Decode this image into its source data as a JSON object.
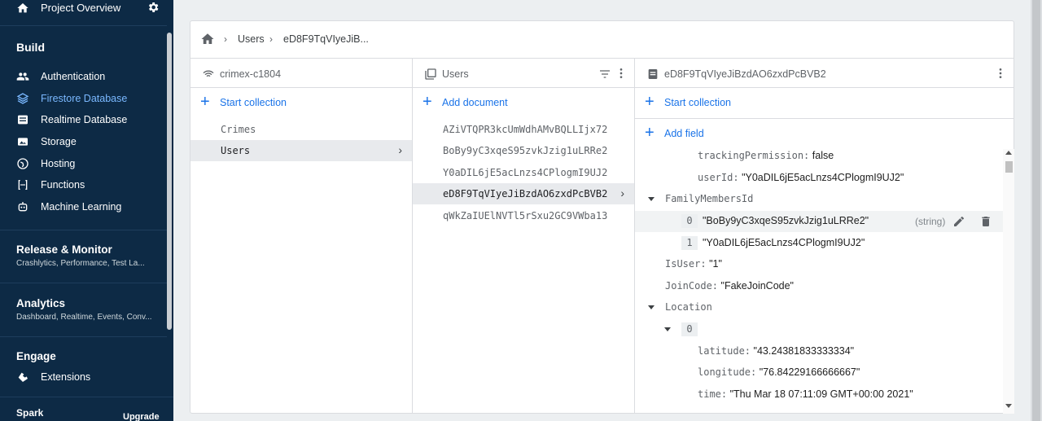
{
  "sidebar": {
    "project_overview": "Project Overview",
    "build_title": "Build",
    "build_items": [
      {
        "label": "Authentication",
        "icon": "users-icon"
      },
      {
        "label": "Firestore Database",
        "icon": "firestore-icon"
      },
      {
        "label": "Realtime Database",
        "icon": "database-icon"
      },
      {
        "label": "Storage",
        "icon": "storage-icon"
      },
      {
        "label": "Hosting",
        "icon": "globe-icon"
      },
      {
        "label": "Functions",
        "icon": "functions-icon"
      },
      {
        "label": "Machine Learning",
        "icon": "robot-icon"
      }
    ],
    "release_title": "Release & Monitor",
    "release_sub": "Crashlytics, Performance, Test La...",
    "analytics_title": "Analytics",
    "analytics_sub": "Dashboard, Realtime, Events, Conv...",
    "engage_title": "Engage",
    "extensions": "Extensions",
    "plan": "Spark",
    "upgrade": "Upgrade",
    "accent_color": "#7ab8ff",
    "bg_color": "#0d2a45"
  },
  "breadcrumb": {
    "items": [
      "Users",
      "eD8F9TqVIyeJiB..."
    ]
  },
  "col1": {
    "header": "crimex-c1804",
    "action": "Start collection",
    "items": [
      "Crimes",
      "Users"
    ],
    "selected": "Users"
  },
  "col2": {
    "header": "Users",
    "action": "Add document",
    "items": [
      "AZiVTQPR3kcUmWdhAMvBQLLIjx72",
      "BoBy9yC3xqeS95zvkJzig1uLRRe2",
      "Y0aDIL6jE5acLnzs4CPlogmI9UJ2",
      "eD8F9TqVIyeJiBzdAO6zxdPcBVB2",
      "qWkZaIUElNVTl5rSxu2GC9VWba13"
    ],
    "selected": "eD8F9TqVIyeJiBzdAO6zxdPcBVB2"
  },
  "col3": {
    "header": "eD8F9TqVIyeJiBzdAO6zxdPcBVB2",
    "action_collection": "Start collection",
    "action_field": "Add field",
    "fields": {
      "tracking_key": "trackingPermission:",
      "tracking_val": "false",
      "userid_key": "userId:",
      "userid_val": "\"Y0aDIL6jE5acLnzs4CPlogmI9UJ2\"",
      "family_key": "FamilyMembersId",
      "family_0_idx": "0",
      "family_0_val": "\"BoBy9yC3xqeS95zvkJzig1uLRRe2\"",
      "family_0_type": "(string)",
      "family_1_idx": "1",
      "family_1_val": "\"Y0aDIL6jE5acLnzs4CPlogmI9UJ2\"",
      "isuser_key": "IsUser:",
      "isuser_val": "\"1\"",
      "joincode_key": "JoinCode:",
      "joincode_val": "\"FakeJoinCode\"",
      "location_key": "Location",
      "location_0_idx": "0",
      "lat_key": "latitude:",
      "lat_val": "\"43.24381833333334\"",
      "lon_key": "longitude:",
      "lon_val": "\"76.84229166666667\"",
      "time_key": "time:",
      "time_val": "\"Thu Mar 18 07:11:09 GMT+00:00 2021\""
    }
  }
}
